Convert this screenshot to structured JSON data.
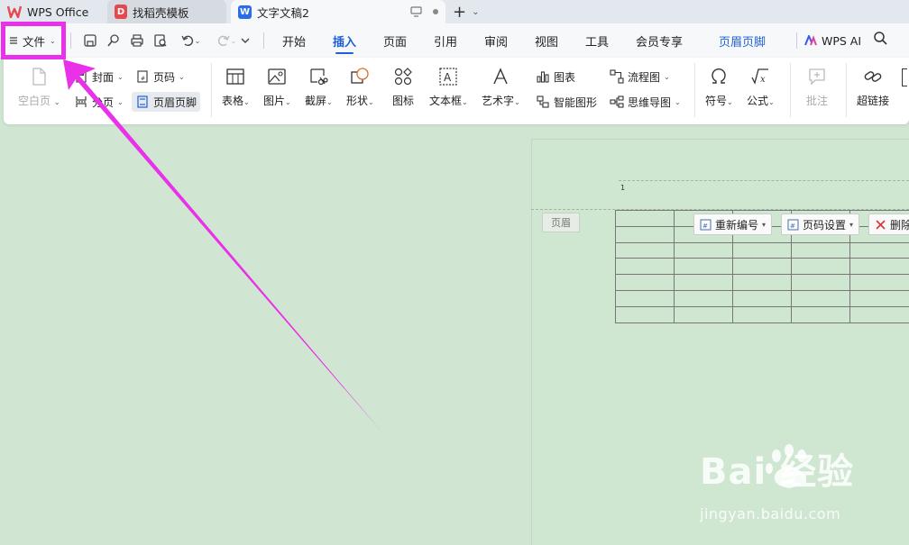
{
  "tabs": [
    {
      "label": "WPS Office"
    },
    {
      "label": "找稻壳模板"
    },
    {
      "label": "文字文稿2"
    }
  ],
  "menu": {
    "file_label": "文件",
    "tabs": [
      "开始",
      "插入",
      "页面",
      "引用",
      "审阅",
      "视图",
      "工具",
      "会员专享",
      "页眉页脚"
    ],
    "active_tab": "插入",
    "wps_ai_label": "WPS AI"
  },
  "ribbon": {
    "blank_page": "空白页",
    "cover": "封面",
    "page_break": "分页",
    "page_number": "页码",
    "header_footer": "页眉页脚",
    "table": "表格",
    "picture": "图片",
    "screenshot": "截屏",
    "shape": "形状",
    "icon": "图标",
    "textbox": "文本框",
    "wordart": "艺术字",
    "chart": "图表",
    "smart_graphic": "智能图形",
    "flowchart": "流程图",
    "mindmap": "思维导图",
    "symbol": "符号",
    "formula": "公式",
    "comment": "批注",
    "hyperlink": "超链接"
  },
  "document": {
    "page_number_marker": "1",
    "header_label": "页眉",
    "renumber_btn": "重新编号",
    "page_setup_btn": "页码设置",
    "delete_btn": "删除"
  },
  "watermark": {
    "brand": "Bai  经验",
    "url": "jingyan.baidu.com"
  },
  "colors": {
    "accent": "#1f5fd6",
    "highlight": "#e831e8",
    "doc_bg": "#cfe6d1"
  }
}
